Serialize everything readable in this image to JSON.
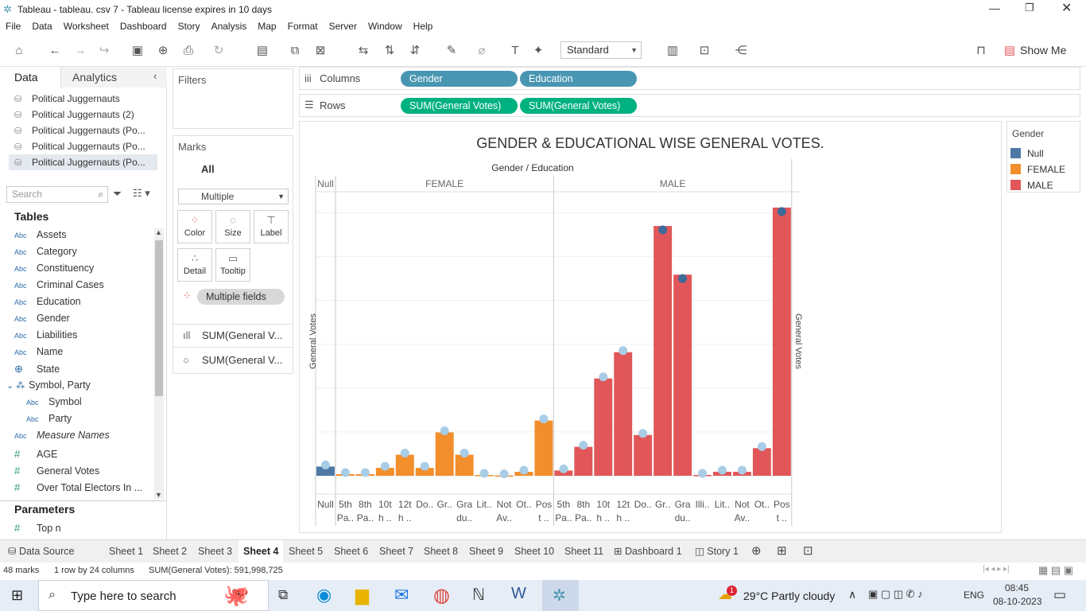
{
  "window": {
    "title": "Tableau - tableau. csv 7 - Tableau license expires in 10 days"
  },
  "menu": [
    "File",
    "Data",
    "Worksheet",
    "Dashboard",
    "Story",
    "Analysis",
    "Map",
    "Format",
    "Server",
    "Window",
    "Help"
  ],
  "toolbar": {
    "fit": "Standard",
    "show_me": "Show Me"
  },
  "left": {
    "tab_data": "Data",
    "tab_analytics": "Analytics",
    "datasources": [
      "Political Juggernauts",
      "Political Juggernauts (2)",
      "Political Juggernauts (Po...",
      "Political Juggernauts (Po...",
      "Political Juggernauts (Po..."
    ],
    "search_placeholder": "Search",
    "tables_title": "Tables",
    "fields": [
      {
        "type": "Abc",
        "name": "Assets"
      },
      {
        "type": "Abc",
        "name": "Category"
      },
      {
        "type": "Abc",
        "name": "Constituency"
      },
      {
        "type": "Abc",
        "name": "Criminal Cases"
      },
      {
        "type": "Abc",
        "name": "Education"
      },
      {
        "type": "Abc",
        "name": "Gender"
      },
      {
        "type": "Abc",
        "name": "Liabilities"
      },
      {
        "type": "Abc",
        "name": "Name"
      },
      {
        "type": "globe",
        "name": "State"
      },
      {
        "type": "hier",
        "name": "Symbol, Party"
      },
      {
        "type": "Abc",
        "name": "Symbol"
      },
      {
        "type": "Abc",
        "name": "Party"
      },
      {
        "type": "Abc",
        "name": "Measure Names"
      },
      {
        "type": "#",
        "name": "AGE"
      },
      {
        "type": "#",
        "name": "General Votes"
      },
      {
        "type": "#",
        "name": "Over Total Electors  In ..."
      }
    ],
    "params_title": "Parameters",
    "param": "Top n",
    "param_type": "#"
  },
  "filters": {
    "title": "Filters"
  },
  "marks": {
    "title": "Marks",
    "all": "All",
    "type": "Multiple",
    "color": "Color",
    "size": "Size",
    "label": "Label",
    "detail": "Detail",
    "tooltip": "Tooltip",
    "multi_fields": "Multiple fields",
    "m1": "SUM(General V...",
    "m2": "SUM(General V..."
  },
  "shelves": {
    "columns": "Columns",
    "rows": "Rows",
    "col1": "Gender",
    "col2": "Education",
    "row1": "SUM(General Votes)",
    "row2": "SUM(General Votes)"
  },
  "legend": {
    "title": "Gender",
    "items": [
      {
        "name": "Null",
        "color": "#4e79a7"
      },
      {
        "name": "FEMALE",
        "color": "#f28e2b"
      },
      {
        "name": "MALE",
        "color": "#e15759"
      }
    ]
  },
  "chart_data": {
    "type": "bar",
    "title": "GENDER & EDUCATIONAL WISE GENERAL VOTES.",
    "header": "Gender  /  Education",
    "ylabel": "General Votes",
    "groups": [
      "Null",
      "FEMALE",
      "MALE"
    ],
    "categories": [
      {
        "g": "Null",
        "label": "Null"
      },
      {
        "g": "FEMALE",
        "label": "5th Pa.."
      },
      {
        "g": "FEMALE",
        "label": "8th Pa.."
      },
      {
        "g": "FEMALE",
        "label": "10t h .."
      },
      {
        "g": "FEMALE",
        "label": "12t h .."
      },
      {
        "g": "FEMALE",
        "label": "Do.."
      },
      {
        "g": "FEMALE",
        "label": "Gr.."
      },
      {
        "g": "FEMALE",
        "label": "Gra du.."
      },
      {
        "g": "FEMALE",
        "label": "Lit.."
      },
      {
        "g": "FEMALE",
        "label": "Not Av.."
      },
      {
        "g": "FEMALE",
        "label": "Ot.."
      },
      {
        "g": "FEMALE",
        "label": "Pos t .."
      },
      {
        "g": "MALE",
        "label": "5th Pa.."
      },
      {
        "g": "MALE",
        "label": "8th Pa.."
      },
      {
        "g": "MALE",
        "label": "10t h .."
      },
      {
        "g": "MALE",
        "label": "12t h .."
      },
      {
        "g": "MALE",
        "label": "Do.."
      },
      {
        "g": "MALE",
        "label": "Gr.."
      },
      {
        "g": "MALE",
        "label": "Gra du.."
      },
      {
        "g": "MALE",
        "label": "Illi.."
      },
      {
        "g": "MALE",
        "label": "Lit.."
      },
      {
        "g": "MALE",
        "label": "Not Av.."
      },
      {
        "g": "MALE",
        "label": "Ot.."
      },
      {
        "g": "MALE",
        "label": "Pos t .."
      }
    ],
    "values": [
      3.5,
      0.6,
      0.6,
      3.0,
      8.0,
      3.0,
      16.5,
      8.0,
      0.3,
      0.1,
      1.5,
      21.0,
      2.0,
      11.0,
      37.0,
      47.0,
      15.5,
      95.0,
      76.5,
      0.3,
      1.5,
      1.5,
      10.5,
      102.0
    ],
    "dark_points": [
      17,
      18,
      23
    ]
  },
  "sheets": [
    "Data Source",
    "Sheet 1",
    "Sheet 2",
    "Sheet 3",
    "Sheet 4",
    "Sheet 5",
    "Sheet 6",
    "Sheet 7",
    "Sheet 8",
    "Sheet 9",
    "Sheet 10",
    "Sheet 11",
    "Dashboard 1",
    "Story 1"
  ],
  "status": {
    "marks": "48 marks",
    "rows": "1 row by 24 columns",
    "sum": "SUM(General Votes): 591,998,725"
  },
  "taskbar": {
    "search": "Type here to search",
    "weather": "29°C  Partly cloudy",
    "lang": "ENG",
    "time": "08:45",
    "date": "08-10-2023",
    "badge": "1"
  }
}
